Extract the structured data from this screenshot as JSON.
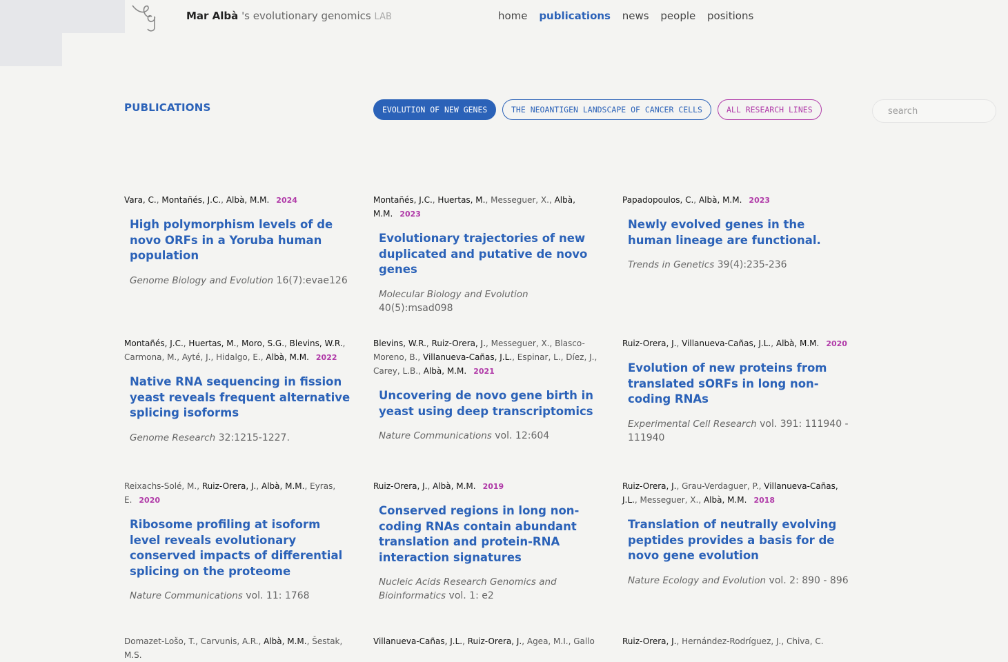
{
  "header": {
    "pi_name": "Mar Albà",
    "subtitle": "'s evolutionary genomics",
    "lab": "LAB",
    "nav": [
      {
        "label": "home",
        "active": false
      },
      {
        "label": "publications",
        "active": true
      },
      {
        "label": "news",
        "active": false
      },
      {
        "label": "people",
        "active": false
      },
      {
        "label": "positions",
        "active": false
      }
    ]
  },
  "section_title": "PUBLICATIONS",
  "filters": [
    {
      "label": "EVOLUTION OF NEW GENES",
      "active": true
    },
    {
      "label": "THE NEOANTIGEN LANDSCAPE OF CANCER CELLS",
      "active": false
    },
    {
      "label": "ALL RESEARCH LINES",
      "active": false
    }
  ],
  "search": {
    "placeholder": "search",
    "value": ""
  },
  "colors": {
    "accent_blue": "#2b62b8",
    "year_magenta": "#b03aa8",
    "background": "#f4f4f2"
  },
  "publications": [
    {
      "authors": [
        {
          "name": "Vara, C.",
          "lab": true
        },
        {
          "name": "Montañés, J.C.",
          "lab": true
        },
        {
          "name": "Albà, M.M.",
          "lab": true
        }
      ],
      "year": "2024",
      "title": "High polymorphism levels of de novo ORFs in a Yoruba human population",
      "journal": "Genome Biology and Evolution",
      "ref": "16(7):evae126"
    },
    {
      "authors": [
        {
          "name": "Montañés, J.C.",
          "lab": true
        },
        {
          "name": "Huertas, M.",
          "lab": true
        },
        {
          "name": "Messeguer, X.",
          "lab": false
        },
        {
          "name": "Albà, M.M.",
          "lab": true
        }
      ],
      "year": "2023",
      "title": "Evolutionary trajectories of new duplicated and putative de novo genes",
      "journal": "Molecular Biology and Evolution",
      "ref": "40(5):msad098"
    },
    {
      "authors": [
        {
          "name": "Papadopoulos, C.",
          "lab": true
        },
        {
          "name": "Albà, M.M.",
          "lab": true
        }
      ],
      "year": "2023",
      "title": "Newly evolved genes in the human lineage are functional.",
      "journal": "Trends in Genetics",
      "ref": "39(4):235-236"
    },
    {
      "authors": [
        {
          "name": "Montañés, J.C.",
          "lab": true
        },
        {
          "name": "Huertas, M.",
          "lab": true
        },
        {
          "name": "Moro, S.G.",
          "lab": true
        },
        {
          "name": "Blevins, W.R.",
          "lab": true
        },
        {
          "name": "Carmona, M.",
          "lab": false
        },
        {
          "name": "Ayté, J.",
          "lab": false
        },
        {
          "name": "Hidalgo, E.",
          "lab": false
        },
        {
          "name": "Albà, M.M.",
          "lab": true
        }
      ],
      "year": "2022",
      "title": "Native RNA sequencing in fission yeast reveals frequent alternative splicing isoforms",
      "journal": "Genome Research",
      "ref": "32:1215-1227."
    },
    {
      "authors": [
        {
          "name": "Blevins, W.R.",
          "lab": true
        },
        {
          "name": "Ruiz-Orera, J.",
          "lab": true
        },
        {
          "name": "Messeguer, X.",
          "lab": false
        },
        {
          "name": "Blasco-Moreno, B.",
          "lab": false
        },
        {
          "name": "Villanueva-Cañas, J.L.",
          "lab": true
        },
        {
          "name": "Espinar, L.",
          "lab": false
        },
        {
          "name": "Díez, J.",
          "lab": false
        },
        {
          "name": "Carey, L.B.",
          "lab": false
        },
        {
          "name": "Albà, M.M.",
          "lab": true
        }
      ],
      "year": "2021",
      "title": "Uncovering de novo gene birth in yeast using deep transcriptomics",
      "journal": "Nature Communications",
      "ref": "vol. 12:604"
    },
    {
      "authors": [
        {
          "name": "Ruiz-Orera, J.",
          "lab": true
        },
        {
          "name": "Villanueva-Cañas, J.L.",
          "lab": true
        },
        {
          "name": "Albà, M.M.",
          "lab": true
        }
      ],
      "year": "2020",
      "title": "Evolution of new proteins from translated sORFs in long non-coding RNAs",
      "journal": "Experimental Cell Research",
      "ref": "vol. 391: 111940 - 111940"
    },
    {
      "authors": [
        {
          "name": "Reixachs-Solé, M.",
          "lab": false
        },
        {
          "name": "Ruiz-Orera, J.",
          "lab": true
        },
        {
          "name": "Albà, M.M.",
          "lab": true
        },
        {
          "name": "Eyras, E.",
          "lab": false
        }
      ],
      "year": "2020",
      "title": "Ribosome profiling at isoform level reveals evolutionary conserved impacts of differential splicing on the proteome",
      "journal": "Nature Communications",
      "ref": "vol. 11: 1768"
    },
    {
      "authors": [
        {
          "name": "Ruiz-Orera, J.",
          "lab": true
        },
        {
          "name": "Albà, M.M.",
          "lab": true
        }
      ],
      "year": "2019",
      "title": "Conserved regions in long non-coding RNAs contain abundant translation and protein-RNA interaction signatures",
      "journal": "Nucleic Acids Research Genomics and Bioinformatics",
      "ref": "vol. 1: e2"
    },
    {
      "authors": [
        {
          "name": "Ruiz-Orera, J.",
          "lab": true
        },
        {
          "name": "Grau-Verdaguer, P.",
          "lab": false
        },
        {
          "name": "Villanueva-Cañas, J.L.",
          "lab": true
        },
        {
          "name": "Messeguer, X.",
          "lab": false
        },
        {
          "name": "Albà, M.M.",
          "lab": true
        }
      ],
      "year": "2018",
      "title": "Translation of neutrally evolving peptides provides a basis for de novo gene evolution",
      "journal": "Nature Ecology and Evolution",
      "ref": "vol. 2: 890 - 896"
    },
    {
      "authors": [
        {
          "name": "Domazet-Lošo, T.",
          "lab": false
        },
        {
          "name": "Carvunis, A.R.",
          "lab": false
        },
        {
          "name": "Albà, M.M.",
          "lab": true
        },
        {
          "name": "Šestak, M.S.",
          "lab": false
        }
      ],
      "year": "",
      "title": "",
      "journal": "",
      "ref": ""
    },
    {
      "authors": [
        {
          "name": "Villanueva-Cañas, J.L.",
          "lab": true
        },
        {
          "name": "Ruiz-Orera, J.",
          "lab": true
        },
        {
          "name": "Agea, M.I.",
          "lab": false
        },
        {
          "name": "Gallo",
          "lab": false
        }
      ],
      "year": "",
      "title": "",
      "journal": "",
      "ref": ""
    },
    {
      "authors": [
        {
          "name": "Ruiz-Orera, J.",
          "lab": true
        },
        {
          "name": "Hernández-Rodríguez, J.",
          "lab": false
        },
        {
          "name": "Chiva, C.",
          "lab": false
        }
      ],
      "year": "",
      "title": "",
      "journal": "",
      "ref": ""
    }
  ]
}
